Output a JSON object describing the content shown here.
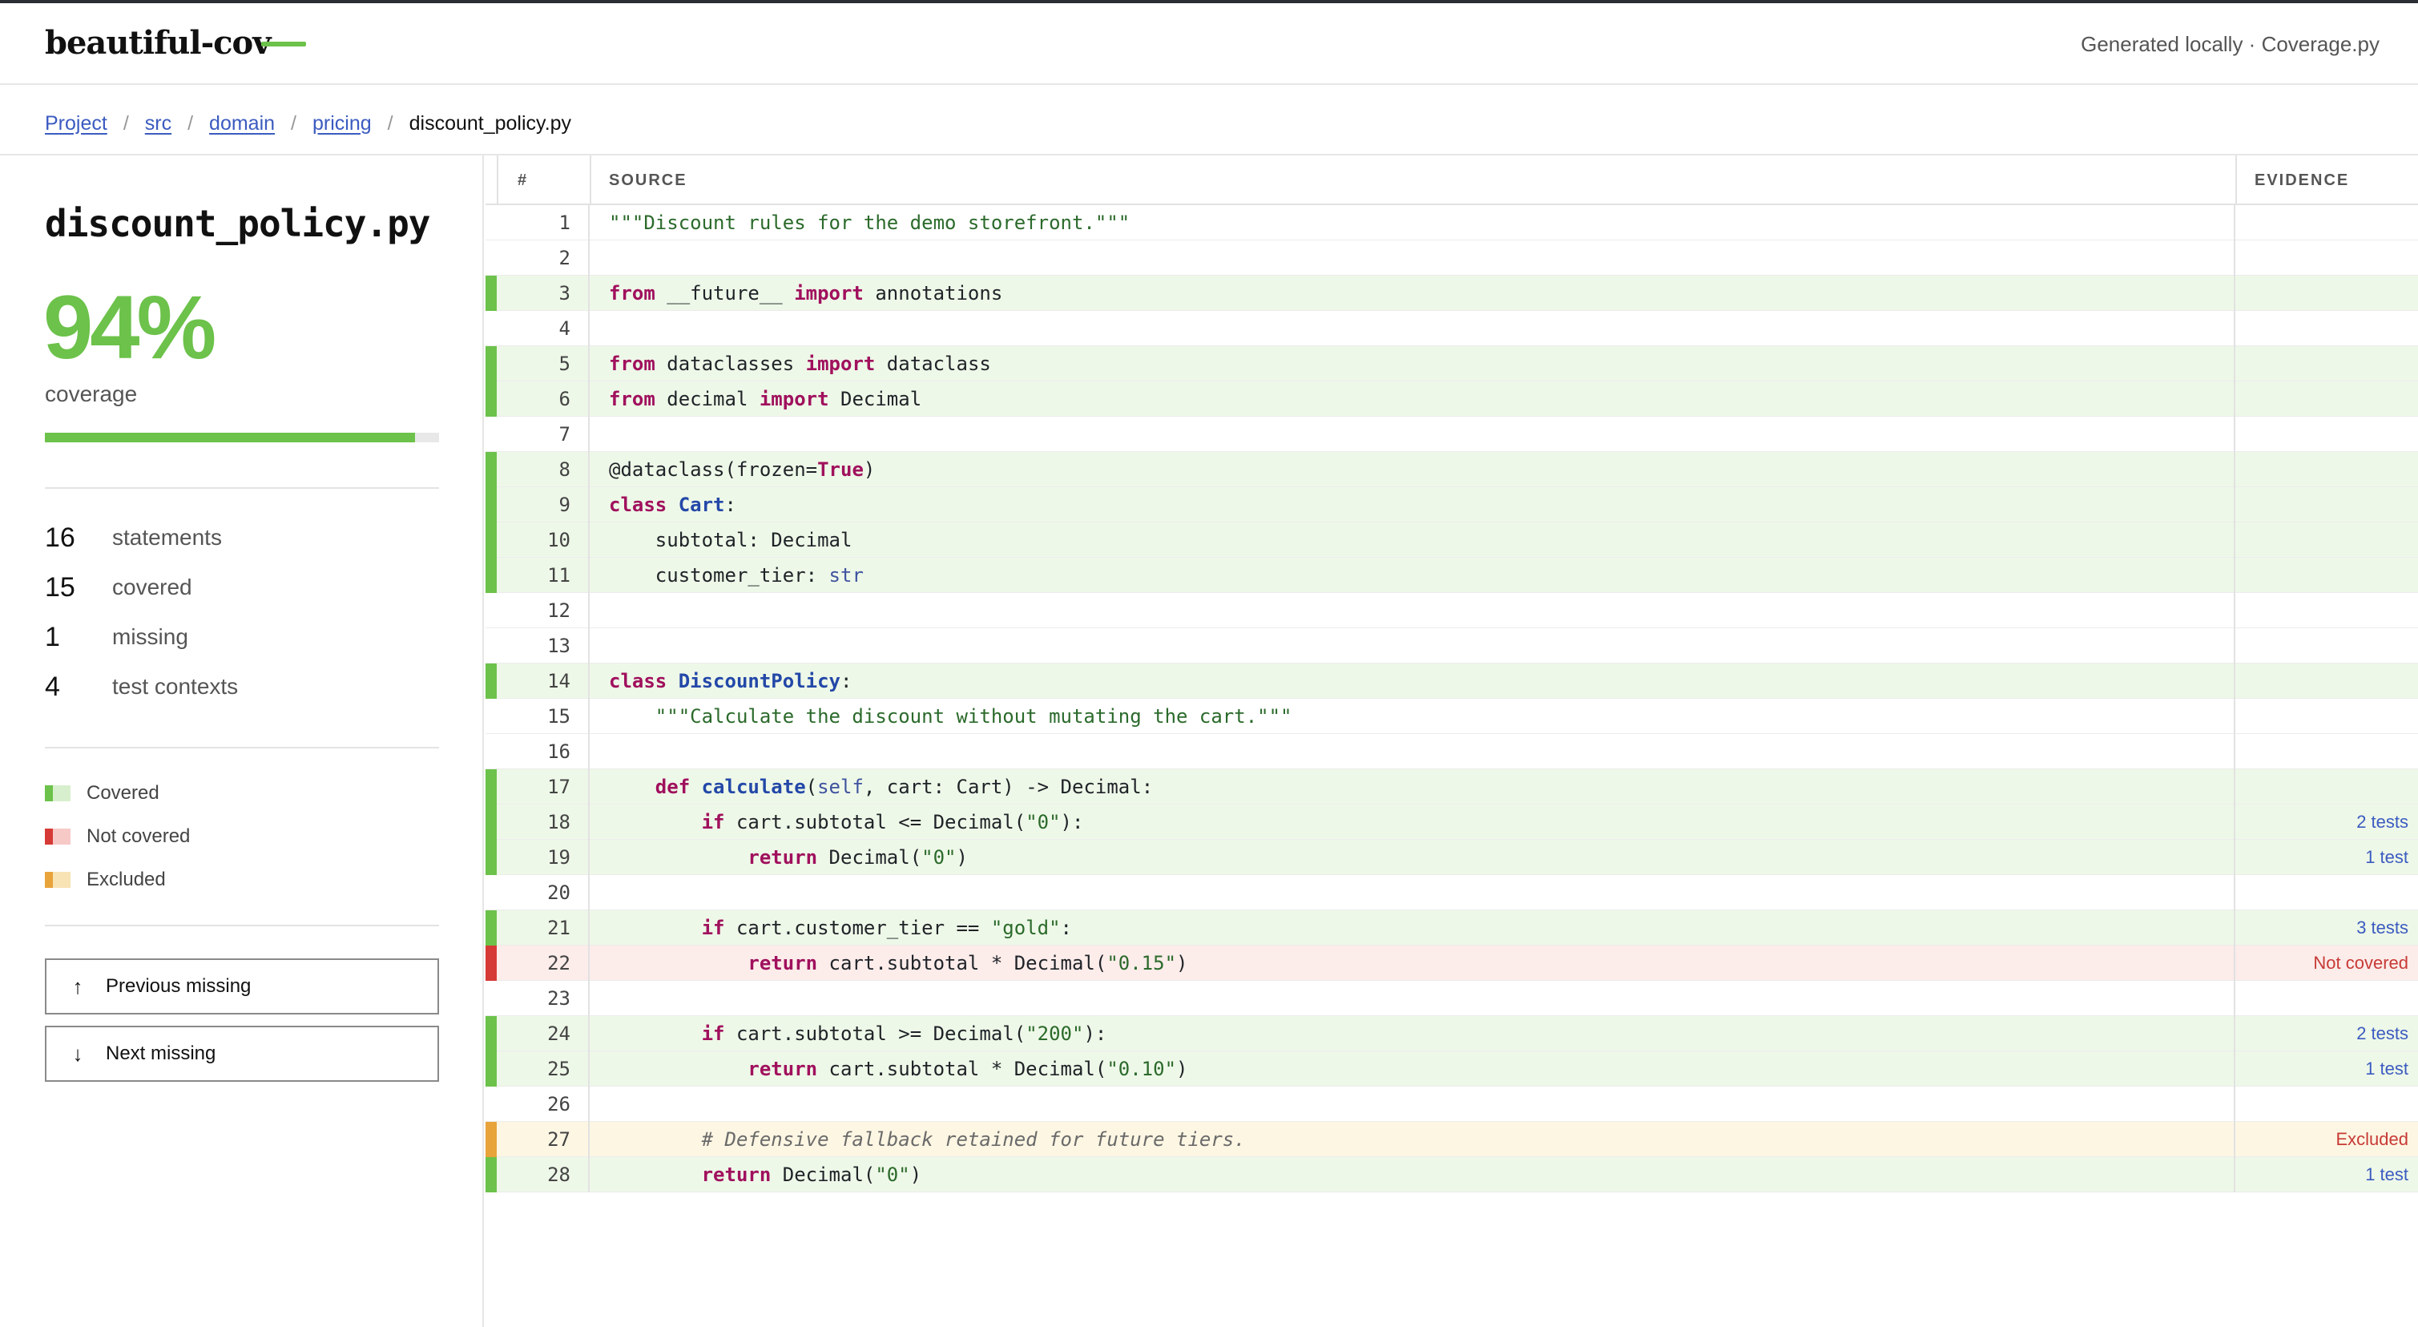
{
  "header": {
    "brand": "beautiful-cov",
    "right_text": "Generated locally · Coverage.py"
  },
  "breadcrumb": {
    "items": [
      "Project",
      "src",
      "domain",
      "pricing"
    ],
    "current": "discount_policy.py"
  },
  "sidebar": {
    "file_title": "discount_policy.py",
    "coverage_percent": "94%",
    "coverage_label": "coverage",
    "coverage_fraction": 0.94,
    "stats": [
      {
        "num": "16",
        "label": "statements"
      },
      {
        "num": "15",
        "label": "covered"
      },
      {
        "num": "1",
        "label": "missing"
      },
      {
        "num": "4",
        "label": "test contexts"
      }
    ],
    "legend": [
      {
        "label": "Covered",
        "dark": "#6cc24a",
        "light": "#d8efcd"
      },
      {
        "label": "Not covered",
        "dark": "#d63a36",
        "light": "#f6c9c7"
      },
      {
        "label": "Excluded",
        "dark": "#e8a33a",
        "light": "#f8e3b5"
      }
    ],
    "prev_label": "Previous missing",
    "next_label": "Next missing"
  },
  "table": {
    "col_num": "#",
    "col_source": "SOURCE",
    "col_evidence": "EVIDENCE"
  },
  "lines": [
    {
      "n": "1",
      "status": "blank",
      "evidence": "",
      "tokens": [
        [
          "str",
          "\"\"\"Discount rules for the demo storefront.\"\"\""
        ]
      ]
    },
    {
      "n": "2",
      "status": "blank",
      "evidence": "",
      "tokens": []
    },
    {
      "n": "3",
      "status": "covered",
      "evidence": "",
      "tokens": [
        [
          "kw",
          "from"
        ],
        [
          "",
          " __future__ "
        ],
        [
          "kw",
          "import"
        ],
        [
          "",
          " annotations"
        ]
      ]
    },
    {
      "n": "4",
      "status": "blank",
      "evidence": "",
      "tokens": []
    },
    {
      "n": "5",
      "status": "covered",
      "evidence": "",
      "tokens": [
        [
          "kw",
          "from"
        ],
        [
          "",
          " dataclasses "
        ],
        [
          "kw",
          "import"
        ],
        [
          "",
          " dataclass"
        ]
      ]
    },
    {
      "n": "6",
      "status": "covered",
      "evidence": "",
      "tokens": [
        [
          "kw",
          "from"
        ],
        [
          "",
          " decimal "
        ],
        [
          "kw",
          "import"
        ],
        [
          "",
          " Decimal"
        ]
      ]
    },
    {
      "n": "7",
      "status": "blank",
      "evidence": "",
      "tokens": []
    },
    {
      "n": "8",
      "status": "covered",
      "evidence": "",
      "tokens": [
        [
          "",
          "@dataclass(frozen="
        ],
        [
          "kw",
          "True"
        ],
        [
          "",
          ")"
        ]
      ]
    },
    {
      "n": "9",
      "status": "covered",
      "evidence": "",
      "tokens": [
        [
          "kw",
          "class"
        ],
        [
          "",
          " "
        ],
        [
          "cls",
          "Cart"
        ],
        [
          "",
          ":"
        ]
      ]
    },
    {
      "n": "10",
      "status": "covered",
      "evidence": "",
      "tokens": [
        [
          "",
          "    subtotal: Decimal"
        ]
      ]
    },
    {
      "n": "11",
      "status": "covered",
      "evidence": "",
      "tokens": [
        [
          "",
          "    customer_tier: "
        ],
        [
          "bi",
          "str"
        ]
      ]
    },
    {
      "n": "12",
      "status": "blank",
      "evidence": "",
      "tokens": []
    },
    {
      "n": "13",
      "status": "blank",
      "evidence": "",
      "tokens": []
    },
    {
      "n": "14",
      "status": "covered",
      "evidence": "",
      "tokens": [
        [
          "kw",
          "class"
        ],
        [
          "",
          " "
        ],
        [
          "cls",
          "DiscountPolicy"
        ],
        [
          "",
          ":"
        ]
      ]
    },
    {
      "n": "15",
      "status": "blank",
      "evidence": "",
      "tokens": [
        [
          "",
          "    "
        ],
        [
          "str",
          "\"\"\"Calculate the discount without mutating the cart.\"\"\""
        ]
      ]
    },
    {
      "n": "16",
      "status": "blank",
      "evidence": "",
      "tokens": []
    },
    {
      "n": "17",
      "status": "covered",
      "evidence": "",
      "tokens": [
        [
          "",
          "    "
        ],
        [
          "kw",
          "def"
        ],
        [
          "",
          " "
        ],
        [
          "fn",
          "calculate"
        ],
        [
          "",
          "("
        ],
        [
          "bi",
          "self"
        ],
        [
          "",
          ", cart: Cart) -> Decimal:"
        ]
      ]
    },
    {
      "n": "18",
      "status": "covered",
      "evidence": "2 tests",
      "tokens": [
        [
          "",
          "        "
        ],
        [
          "kw",
          "if"
        ],
        [
          "",
          " cart.subtotal <= Decimal("
        ],
        [
          "str",
          "\"0\""
        ],
        [
          "",
          "):"
        ]
      ]
    },
    {
      "n": "19",
      "status": "covered",
      "evidence": "1 test",
      "tokens": [
        [
          "",
          "            "
        ],
        [
          "kw",
          "return"
        ],
        [
          "",
          " Decimal("
        ],
        [
          "str",
          "\"0\""
        ],
        [
          "",
          ")"
        ]
      ]
    },
    {
      "n": "20",
      "status": "blank",
      "evidence": "",
      "tokens": []
    },
    {
      "n": "21",
      "status": "covered",
      "evidence": "3 tests",
      "tokens": [
        [
          "",
          "        "
        ],
        [
          "kw",
          "if"
        ],
        [
          "",
          " cart.customer_tier == "
        ],
        [
          "str",
          "\"gold\""
        ],
        [
          "",
          ":"
        ]
      ]
    },
    {
      "n": "22",
      "status": "missing",
      "evidence": "Not covered",
      "tokens": [
        [
          "",
          "            "
        ],
        [
          "kw",
          "return"
        ],
        [
          "",
          " cart.subtotal * Decimal("
        ],
        [
          "str",
          "\"0.15\""
        ],
        [
          "",
          ")"
        ]
      ]
    },
    {
      "n": "23",
      "status": "blank",
      "evidence": "",
      "tokens": []
    },
    {
      "n": "24",
      "status": "covered",
      "evidence": "2 tests",
      "tokens": [
        [
          "",
          "        "
        ],
        [
          "kw",
          "if"
        ],
        [
          "",
          " cart.subtotal >= Decimal("
        ],
        [
          "str",
          "\"200\""
        ],
        [
          "",
          "):"
        ]
      ]
    },
    {
      "n": "25",
      "status": "covered",
      "evidence": "1 test",
      "tokens": [
        [
          "",
          "            "
        ],
        [
          "kw",
          "return"
        ],
        [
          "",
          " cart.subtotal * Decimal("
        ],
        [
          "str",
          "\"0.10\""
        ],
        [
          "",
          ")"
        ]
      ]
    },
    {
      "n": "26",
      "status": "blank",
      "evidence": "",
      "tokens": []
    },
    {
      "n": "27",
      "status": "excluded",
      "evidence": "Excluded",
      "tokens": [
        [
          "",
          "        "
        ],
        [
          "cm",
          "# Defensive fallback retained for future tiers."
        ]
      ]
    },
    {
      "n": "28",
      "status": "covered",
      "evidence": "1 test",
      "tokens": [
        [
          "",
          "        "
        ],
        [
          "kw",
          "return"
        ],
        [
          "",
          " Decimal("
        ],
        [
          "str",
          "\"0\""
        ],
        [
          "",
          ")"
        ]
      ]
    }
  ]
}
